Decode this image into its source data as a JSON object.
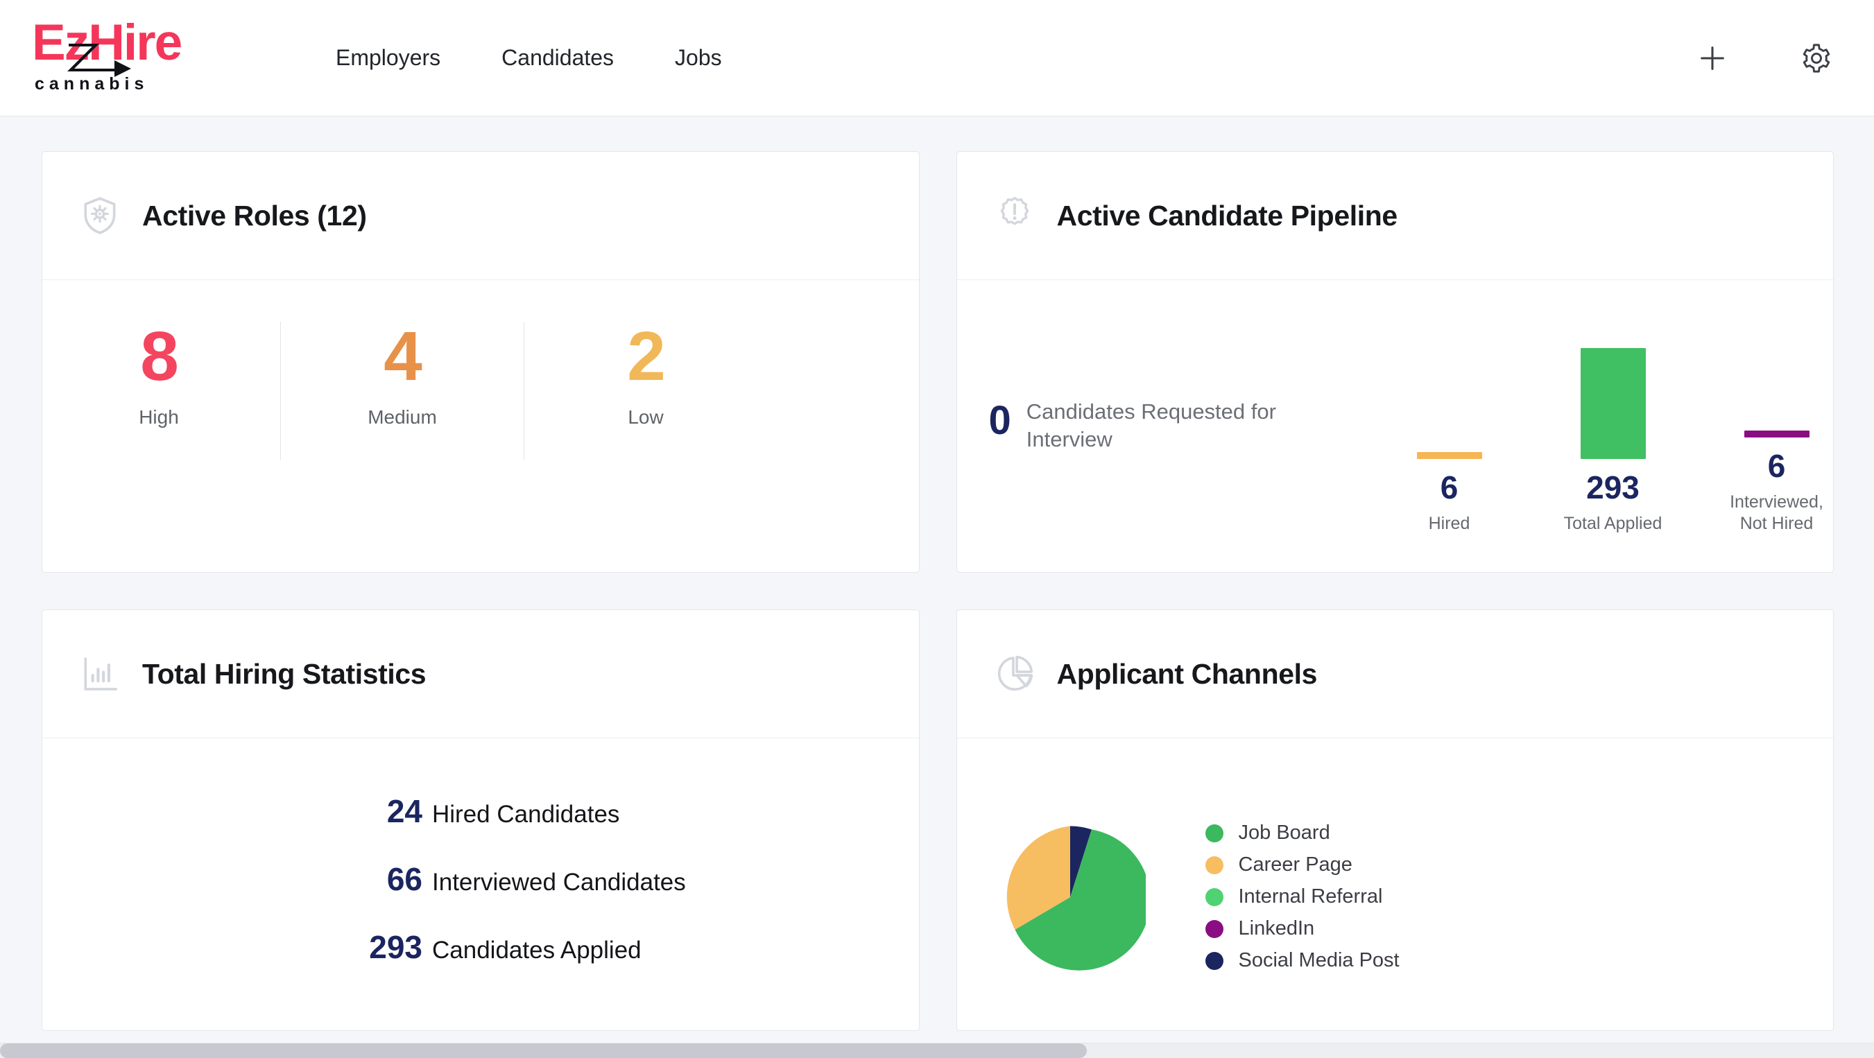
{
  "header": {
    "logo": {
      "primary": "EzHire",
      "sub": "cannabis",
      "primary_color": "#f4365a",
      "sub_color": "#111218"
    },
    "nav": [
      {
        "label": "Employers"
      },
      {
        "label": "Candidates"
      },
      {
        "label": "Jobs"
      }
    ],
    "actions": [
      {
        "name": "add",
        "icon": "plus-icon"
      },
      {
        "name": "settings",
        "icon": "gear-icon"
      }
    ]
  },
  "cards": {
    "active_roles": {
      "title": "Active Roles (12)",
      "icon": "shield-gear-icon",
      "items": [
        {
          "value": "8",
          "label": "High",
          "color": "#f4455f"
        },
        {
          "value": "4",
          "label": "Medium",
          "color": "#e89149"
        },
        {
          "value": "2",
          "label": "Low",
          "color": "#f0b858"
        }
      ]
    },
    "pipeline": {
      "title": "Active Candidate Pipeline",
      "icon": "alert-badge-icon",
      "requested_value": "0",
      "requested_label": "Candidates Requested for Interview"
    },
    "hiring_statistics": {
      "title": "Total Hiring Statistics",
      "icon": "bar-chart-icon",
      "rows": [
        {
          "value": "24",
          "label": "Hired Candidates"
        },
        {
          "value": "66",
          "label": "Interviewed Candidates"
        },
        {
          "value": "293",
          "label": "Candidates Applied"
        }
      ]
    },
    "applicant_channels": {
      "title": "Applicant Channels",
      "icon": "pie-chart-icon"
    }
  },
  "chart_data": [
    {
      "type": "bar",
      "title": "Active Candidate Pipeline",
      "categories": [
        "Hired",
        "Total Applied",
        "Interviewed, Not Hired"
      ],
      "values": [
        6,
        293,
        6
      ],
      "colors": [
        "#f7b553",
        "#40bf63",
        "#8a0d83"
      ],
      "value_labels": [
        "6",
        "293",
        "6"
      ],
      "xlabel": "",
      "ylabel": "",
      "ylim": [
        0,
        293
      ],
      "grid": false,
      "legend": "none"
    },
    {
      "type": "pie",
      "title": "Applicant Channels",
      "categories": [
        "Job Board",
        "Career Page",
        "Internal Referral",
        "LinkedIn",
        "Social Media Post"
      ],
      "values": [
        62,
        33,
        0,
        0,
        5
      ],
      "colors": [
        "#3cb85f",
        "#f7bd61",
        "#4fd273",
        "#8a0d83",
        "#1b2560"
      ],
      "legend": "right",
      "start_angle": 90
    }
  ],
  "legend": [
    {
      "label": "Job Board",
      "color": "#3cb85f"
    },
    {
      "label": "Career Page",
      "color": "#f7bd61"
    },
    {
      "label": "Internal Referral",
      "color": "#4fd273"
    },
    {
      "label": "LinkedIn",
      "color": "#8a0d83"
    },
    {
      "label": "Social Media Post",
      "color": "#1b2560"
    }
  ]
}
